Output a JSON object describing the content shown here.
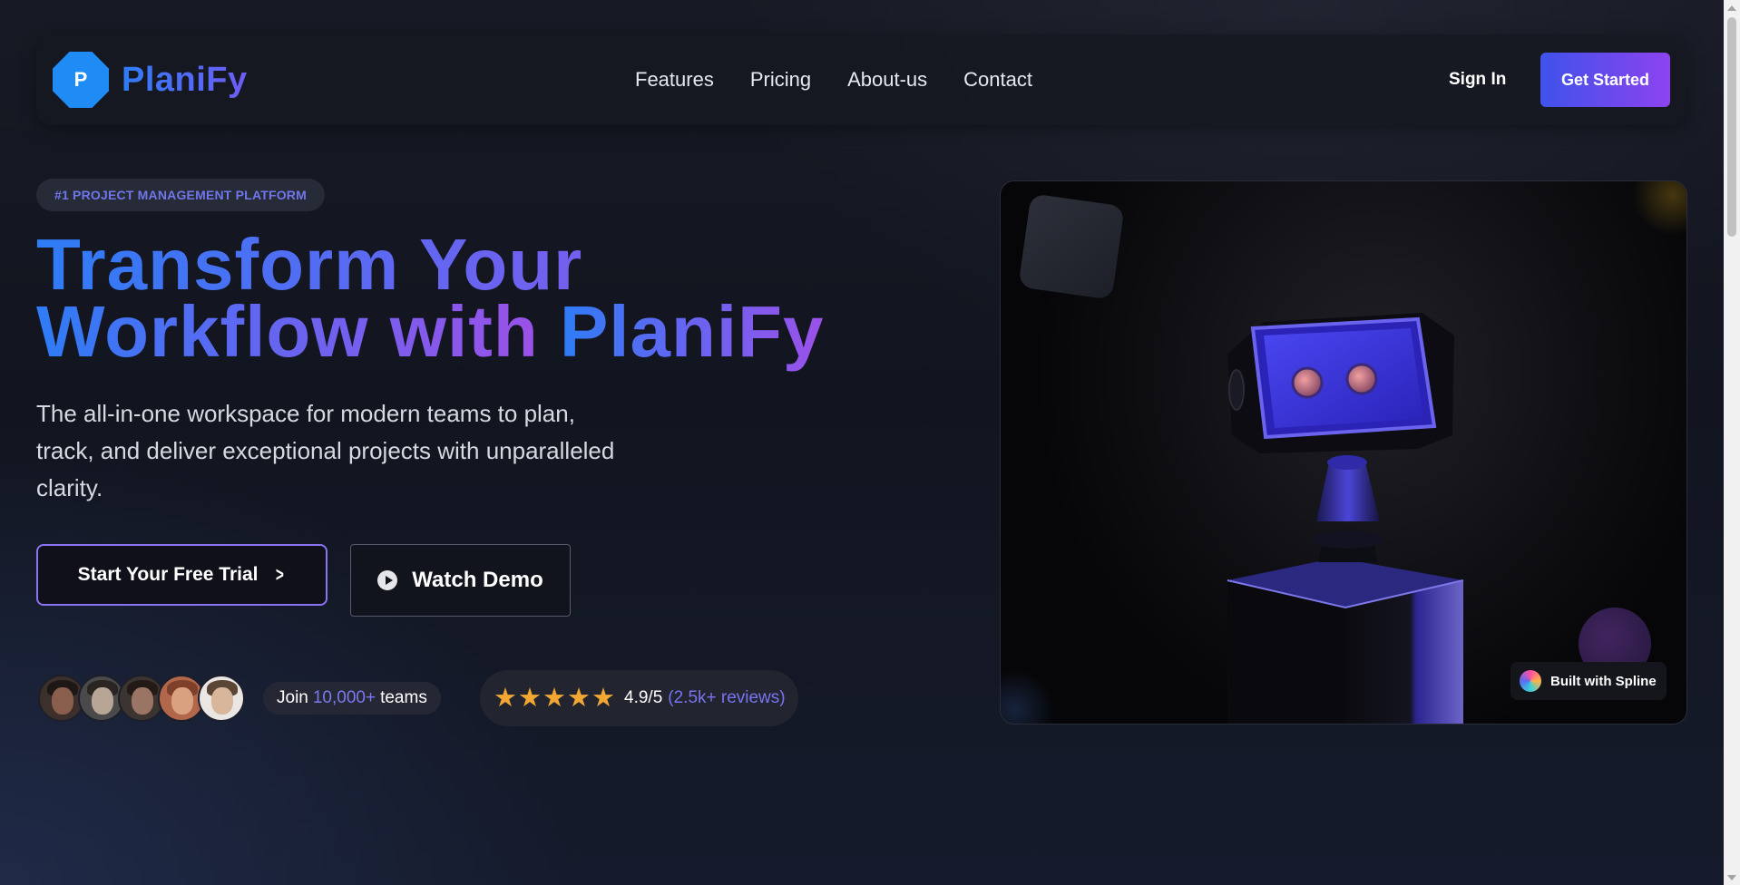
{
  "brand": {
    "logo_letter": "P",
    "name": "PlaniFy"
  },
  "nav": {
    "links": [
      "Features",
      "Pricing",
      "About-us",
      "Contact"
    ],
    "sign_in": "Sign In",
    "get_started": "Get Started"
  },
  "hero": {
    "badge": "#1 PROJECT MANAGEMENT PLATFORM",
    "headline_line1": "Transform Your",
    "headline_line2_plain": "Workflow with",
    "headline_line2_brand": "PlaniFy",
    "subtext": "The all-in-one workspace for modern teams to plan, track, and deliver exceptional projects with unparalleled clarity.",
    "cta_primary": "Start Your Free Trial",
    "cta_secondary": "Watch Demo"
  },
  "social_proof": {
    "join_prefix": "Join",
    "join_count": "10,000+",
    "join_suffix": "teams",
    "stars": 5,
    "rating": "4.9/5",
    "reviews": "(2.5k+ reviews)",
    "avatar_count": 5
  },
  "media": {
    "spline_badge": "Built with Spline"
  },
  "colors": {
    "accent_blue": "#2f7cf6",
    "accent_purple": "#9b51e8",
    "star": "#f3a733",
    "robot_blue": "#3a2fd6"
  }
}
